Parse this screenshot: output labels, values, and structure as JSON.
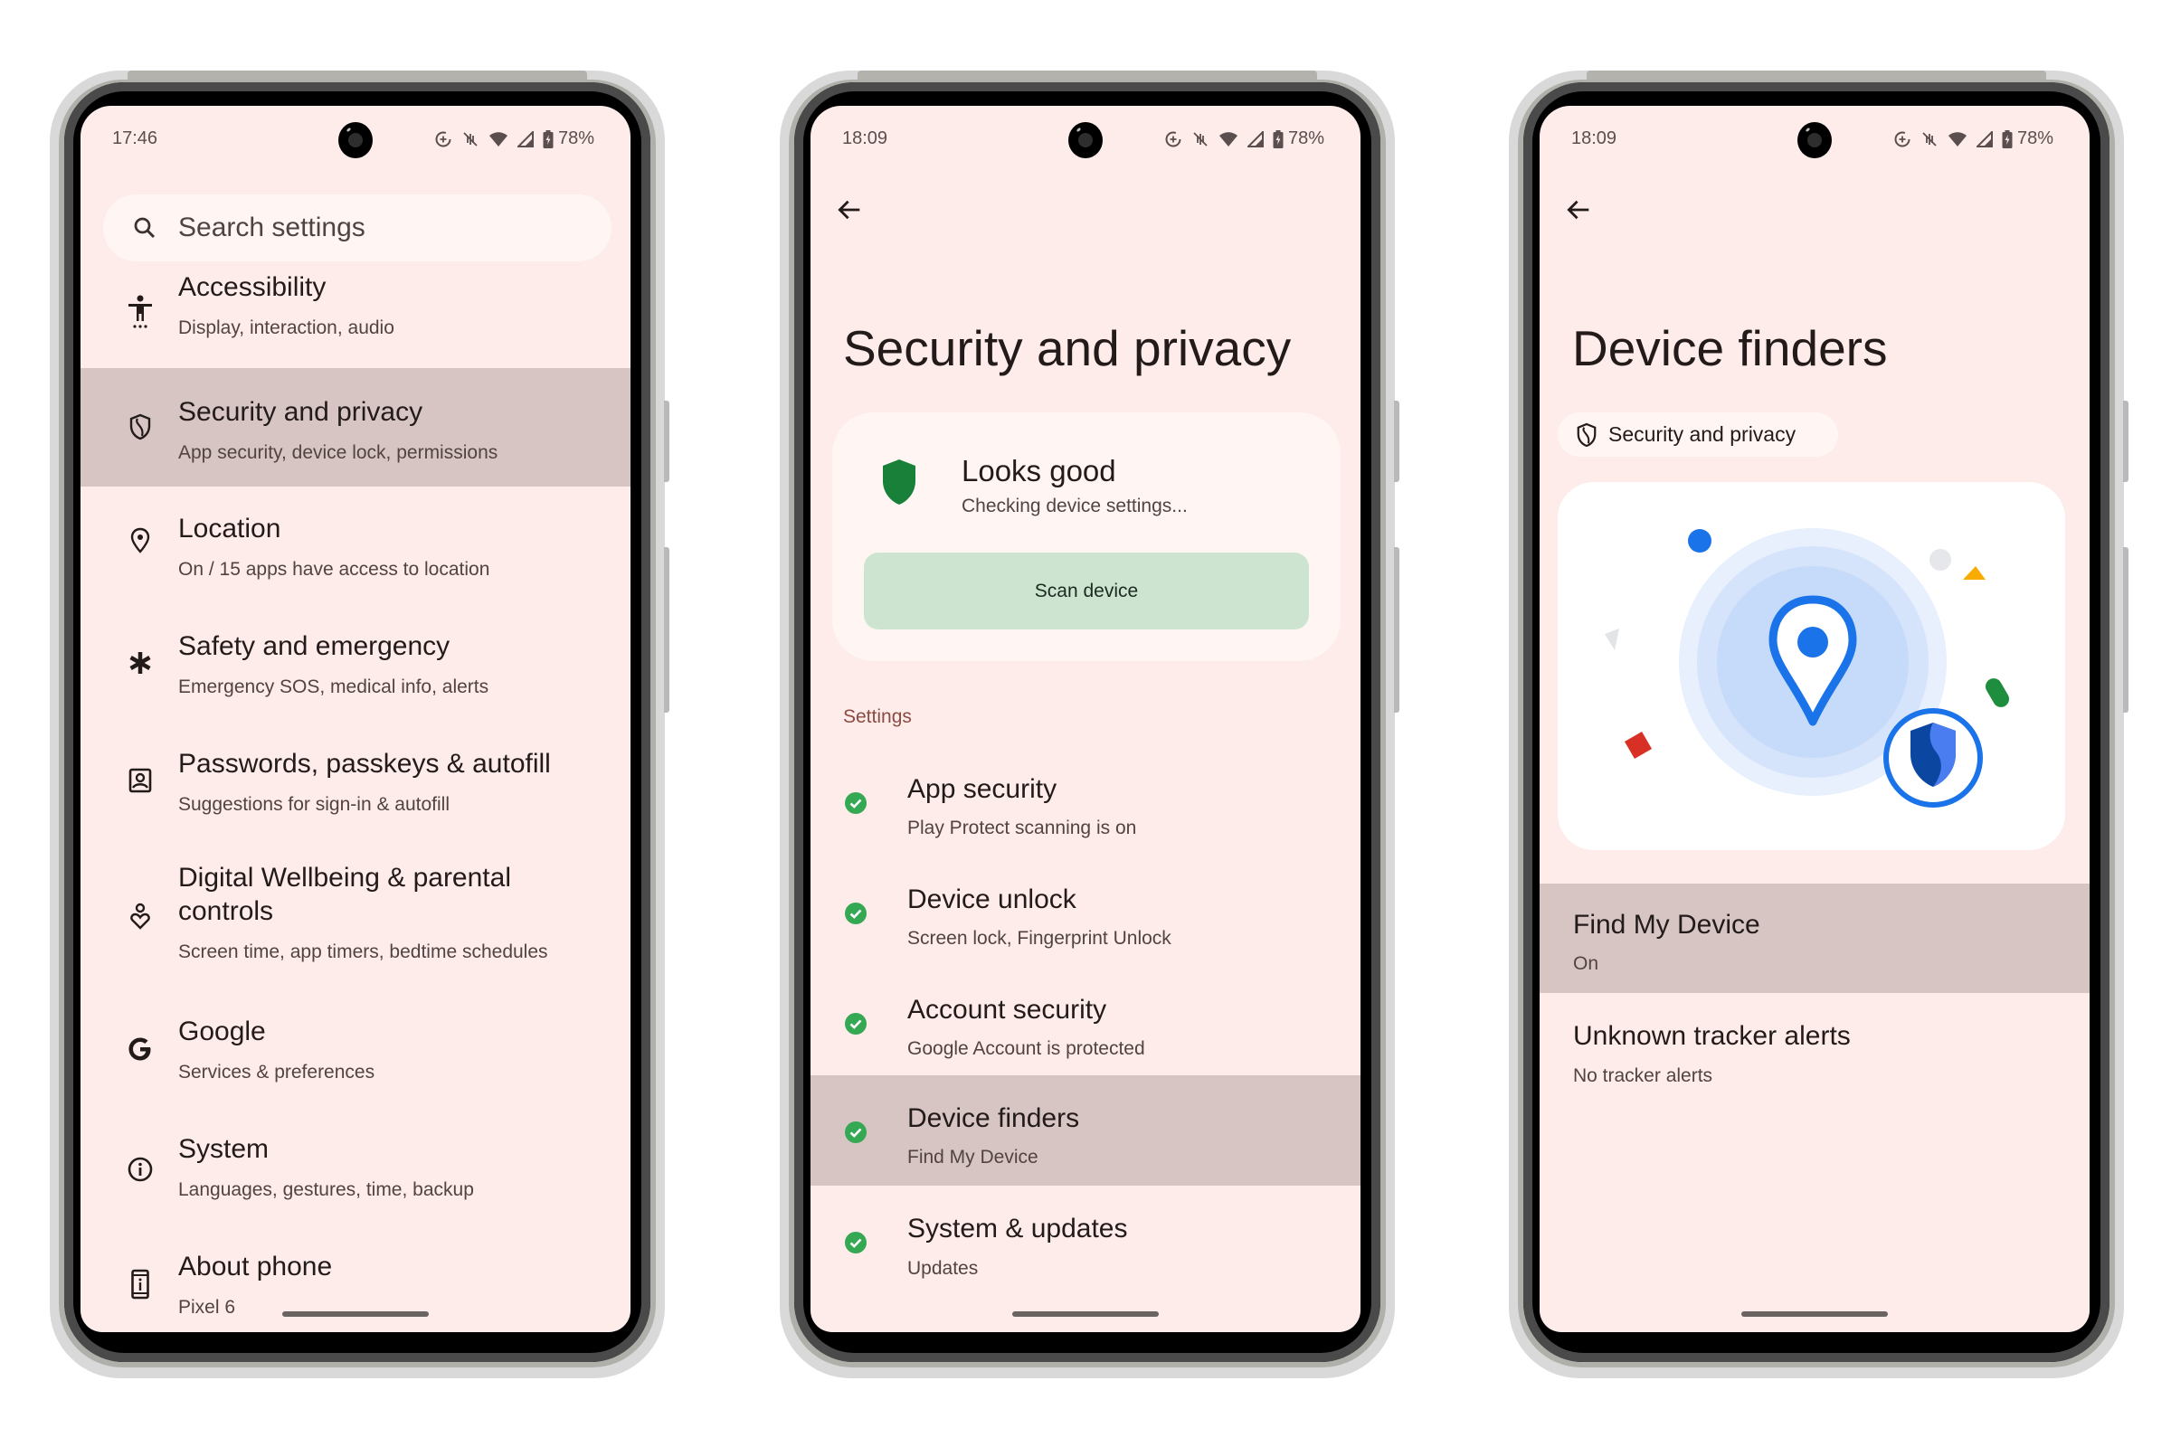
{
  "status_bar": {
    "battery": "78%",
    "icons": [
      "data-saver-icon",
      "vibrate-off-icon",
      "wifi-icon",
      "signal-icon",
      "battery-charging-icon"
    ]
  },
  "screens": [
    {
      "time": "17:46",
      "search": {
        "placeholder": "Search settings"
      },
      "items": [
        {
          "icon": "accessibility-icon",
          "title": "Accessibility",
          "subtitle": "Display, interaction, audio",
          "highlighted": false
        },
        {
          "icon": "shield-icon",
          "title": "Security and privacy",
          "subtitle": "App security, device lock, permissions",
          "highlighted": true
        },
        {
          "icon": "location-pin-icon",
          "title": "Location",
          "subtitle": "On / 15 apps have access to location",
          "highlighted": false
        },
        {
          "icon": "asterisk-icon",
          "title": "Safety and emergency",
          "subtitle": "Emergency SOS, medical info, alerts",
          "highlighted": false
        },
        {
          "icon": "account-box-icon",
          "title": "Passwords, passkeys & autofill",
          "subtitle": "Suggestions for sign-in & autofill",
          "highlighted": false
        },
        {
          "icon": "wellbeing-icon",
          "title": "Digital Wellbeing & parental",
          "title2": "controls",
          "subtitle": "Screen time, app timers, bedtime schedules",
          "highlighted": false
        },
        {
          "icon": "google-g-icon",
          "title": "Google",
          "subtitle": "Services & preferences",
          "highlighted": false
        },
        {
          "icon": "info-icon",
          "title": "System",
          "subtitle": "Languages, gestures, time, backup",
          "highlighted": false
        },
        {
          "icon": "phone-info-icon",
          "title": "About phone",
          "subtitle": "Pixel 6",
          "highlighted": false
        }
      ]
    },
    {
      "time": "18:09",
      "title": "Security and privacy",
      "status_card": {
        "title": "Looks good",
        "subtitle": "Checking device settings...",
        "button": "Scan device",
        "shield_color": "#188038",
        "button_color": "#cde5d0"
      },
      "section_label": "Settings",
      "items": [
        {
          "title": "App security",
          "subtitle": "Play Protect scanning is on",
          "status": "ok",
          "highlighted": false
        },
        {
          "title": "Device unlock",
          "subtitle": "Screen lock, Fingerprint Unlock",
          "status": "ok",
          "highlighted": false
        },
        {
          "title": "Account security",
          "subtitle": "Google Account is protected",
          "status": "ok",
          "highlighted": false
        },
        {
          "title": "Device finders",
          "subtitle": "Find My Device",
          "status": "ok",
          "highlighted": true
        },
        {
          "title": "System & updates",
          "subtitle": "Updates",
          "status": "ok",
          "highlighted": false
        }
      ]
    },
    {
      "time": "18:09",
      "title": "Device finders",
      "chip": "Security and privacy",
      "illustration": "location-pin-with-shield-illustration",
      "items": [
        {
          "title": "Find My Device",
          "subtitle": "On",
          "highlighted": true
        },
        {
          "title": "Unknown tracker alerts",
          "subtitle": "No tracker alerts",
          "highlighted": false
        }
      ]
    }
  ],
  "colors": {
    "screen_bg": "#fdece9",
    "highlight": "#d6c5c3",
    "check_green": "#34a853",
    "section_label": "#8c4a42",
    "accent_blue": "#1a73e8"
  }
}
